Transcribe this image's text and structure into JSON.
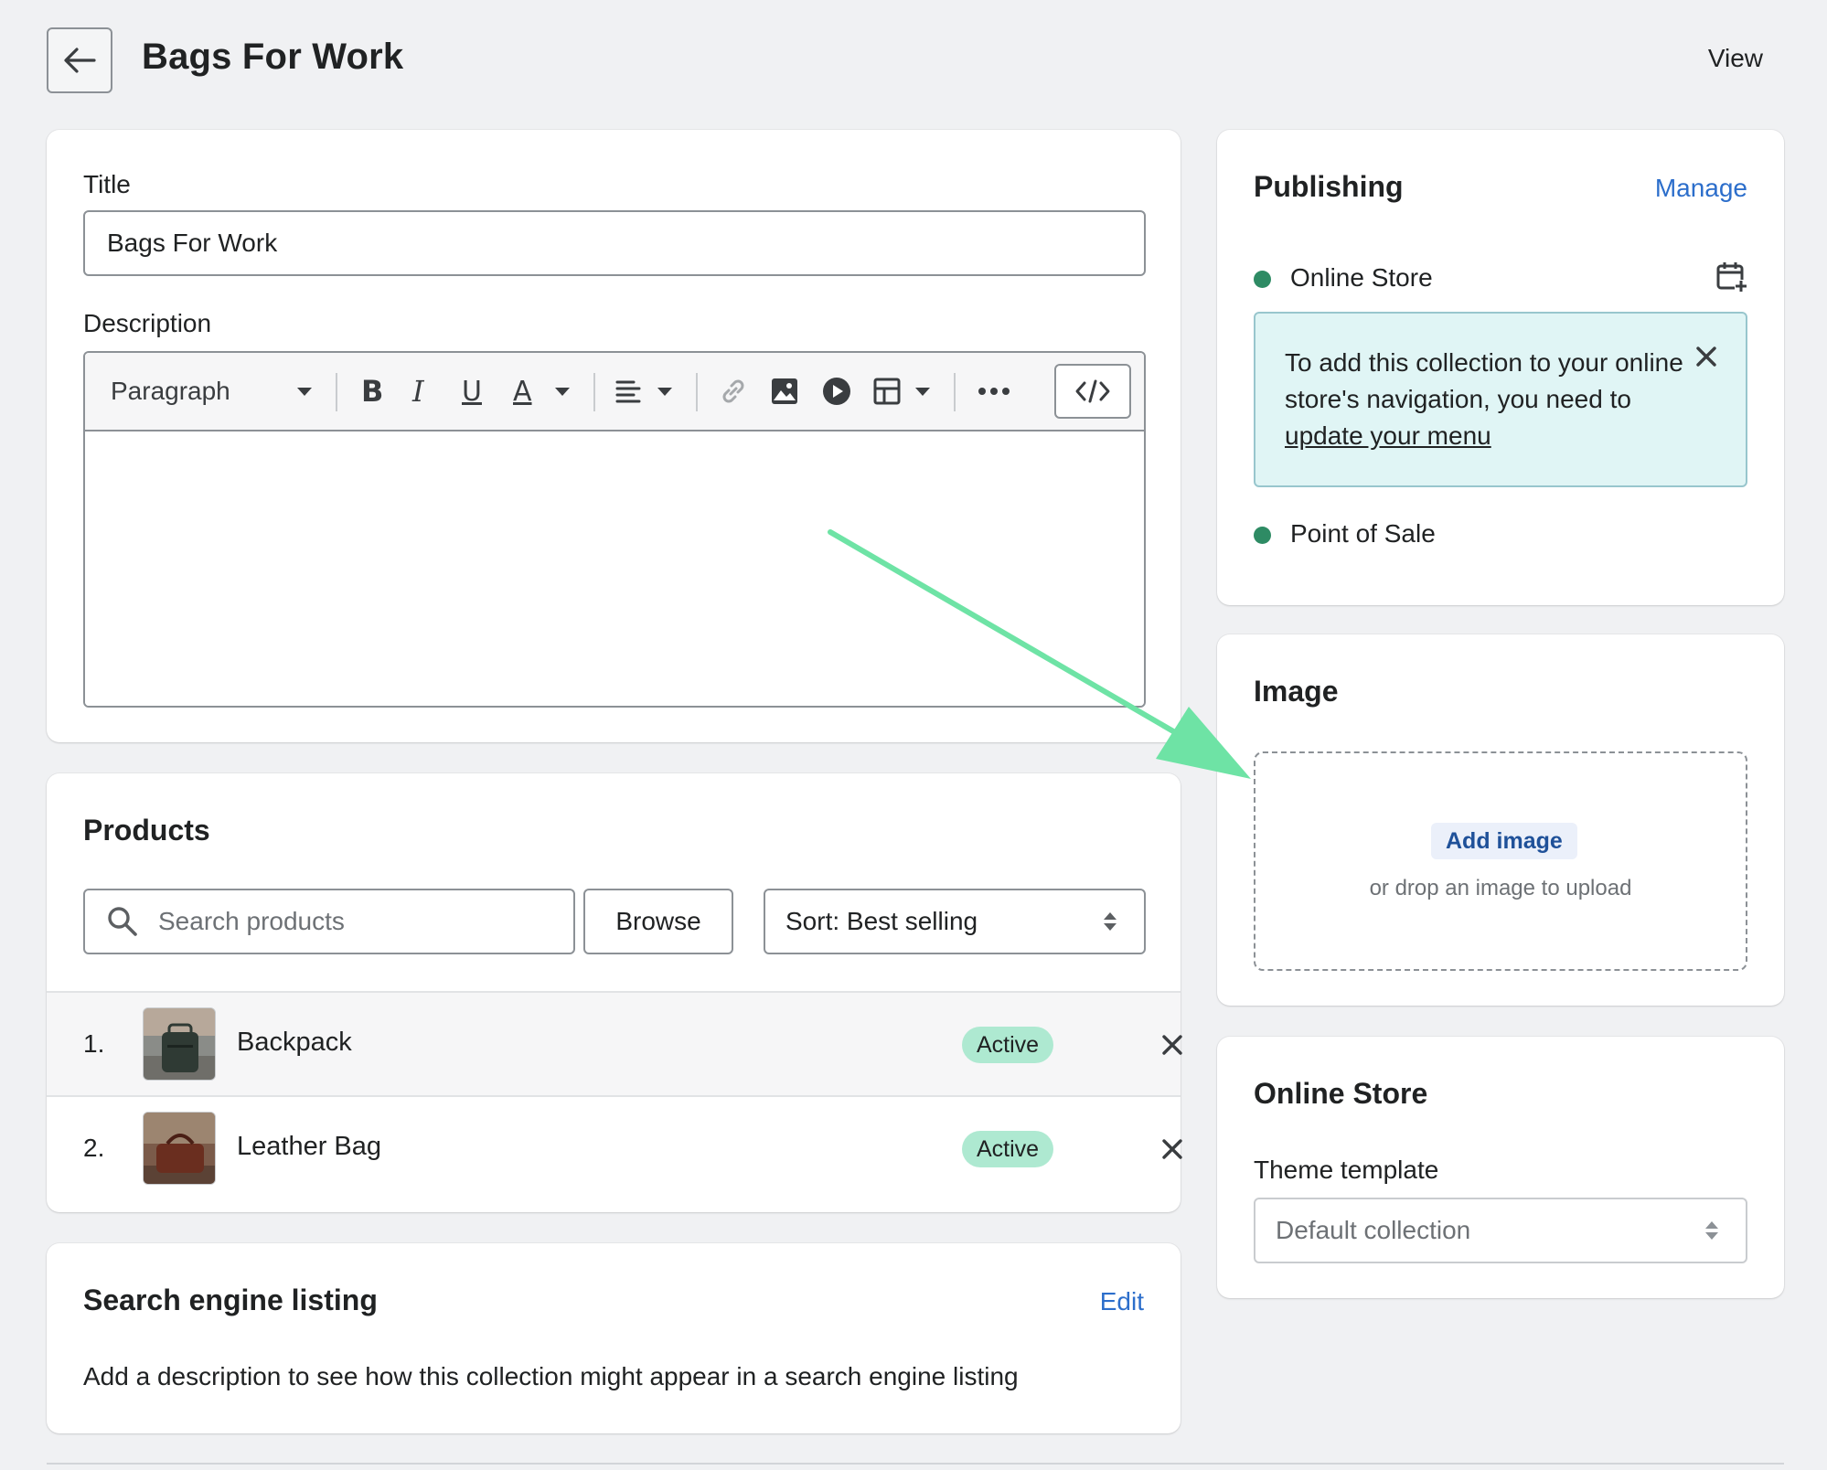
{
  "header": {
    "title": "Bags For Work",
    "view_label": "View"
  },
  "title_section": {
    "label": "Title",
    "value": "Bags For Work",
    "description_label": "Description"
  },
  "editor": {
    "paragraph_style": "Paragraph",
    "tools": [
      "bold-icon",
      "italic-icon",
      "underline-icon",
      "text-color-icon",
      "align-icon",
      "link-icon",
      "image-icon",
      "video-icon",
      "table-icon",
      "more-icon",
      "code-icon"
    ]
  },
  "products": {
    "heading": "Products",
    "search_placeholder": "Search products",
    "browse_label": "Browse",
    "sort_label": "Sort: Best selling",
    "items": [
      {
        "index": "1.",
        "name": "Backpack",
        "status": "Active"
      },
      {
        "index": "2.",
        "name": "Leather Bag",
        "status": "Active"
      }
    ]
  },
  "seo": {
    "heading": "Search engine listing",
    "edit_label": "Edit",
    "description": "Add a description to see how this collection might appear in a search engine listing"
  },
  "publishing": {
    "heading": "Publishing",
    "manage_label": "Manage",
    "channels": [
      {
        "name": "Online Store"
      },
      {
        "name": "Point of Sale"
      }
    ],
    "banner_text": "To add this collection to your online store's navigation, you need to ",
    "banner_link": "update your menu"
  },
  "image": {
    "heading": "Image",
    "add_label": "Add image",
    "hint": "or drop an image to upload"
  },
  "online_store": {
    "heading": "Online Store",
    "template_label": "Theme template",
    "template_value": "Default collection"
  },
  "colors": {
    "accent": "#2c6ecb",
    "badge": "#aee9d1",
    "status_dot": "#2e8b64",
    "annotation_arrow": "#6ee3a5"
  }
}
